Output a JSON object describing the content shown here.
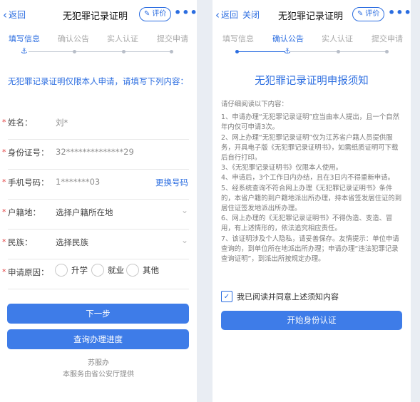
{
  "left": {
    "back_label": "返回",
    "title": "无犯罪记录证明",
    "rate_label": "评价",
    "more_label": "•••",
    "steps": [
      "填写信息",
      "确认公告",
      "实人认证",
      "提交申请"
    ],
    "intro": "无犯罪记录证明仅限本人申请，请填写下列内容：",
    "fields": {
      "name_label": "姓名：",
      "name_value": "刘*",
      "id_label": "身份证号：",
      "id_value": "32**************29",
      "phone_label": "手机号码：",
      "phone_value": "1*******03",
      "change_phone": "更换号码",
      "household_label": "户籍地：",
      "household_placeholder": "选择户籍所在地",
      "ethnic_label": "民族：",
      "ethnic_placeholder": "选择民族",
      "reason_label": "申请原因：",
      "reason_options": [
        "升学",
        "就业",
        "其他"
      ]
    },
    "next_button": "下一步",
    "progress_button": "查询办理进度",
    "footer_app": "苏服办",
    "footer_provider": "本服务由省公安厅提供"
  },
  "right": {
    "back_label": "返回",
    "close_label": "关闭",
    "title": "无犯罪记录证明",
    "rate_label": "评价",
    "more_label": "•••",
    "steps": [
      "填写信息",
      "确认公告",
      "实人认证",
      "提交申请"
    ],
    "notice_title": "无犯罪记录证明申报须知",
    "notice_intro": "请仔细阅读以下内容：",
    "notice_items": [
      "1、申请办理“无犯罪记录证明”应当由本人提出，且一个自然年内仅可申请3次。",
      "2、网上办理“无犯罪记录证明”仅为江苏省户籍人员提供服务，开具电子版《无犯罪记录证明书》，如需纸质证明可下载后自行打印。",
      "3、《无犯罪记录证明书》仅限本人使用。",
      "4、申请后，3个工作日内办结，且在3日内不得重新申请。",
      "5、经系统查询不符合网上办理《无犯罪记录证明书》条件的，本省户籍的到户籍地派出所办理，持本省签发居住证的到居住证签发地派出所办理。",
      "6、网上办理的《无犯罪记录证明书》不得伪造、变造、冒用，有上述情形的，依法追究相应责任。",
      "7、该证明涉及个人隐私，请妥善保存。友情提示：单位申请查询的，到单位所在地派出所办理；申请办理“违法犯罪记录查询证明”，到派出所按规定办理。"
    ],
    "agree_label": "我已阅读并同意上述须知内容",
    "start_button": "开始身份认证"
  },
  "colors": {
    "accent": "#2b6de0",
    "button": "#3e7ce8",
    "required": "#e23b3b"
  }
}
